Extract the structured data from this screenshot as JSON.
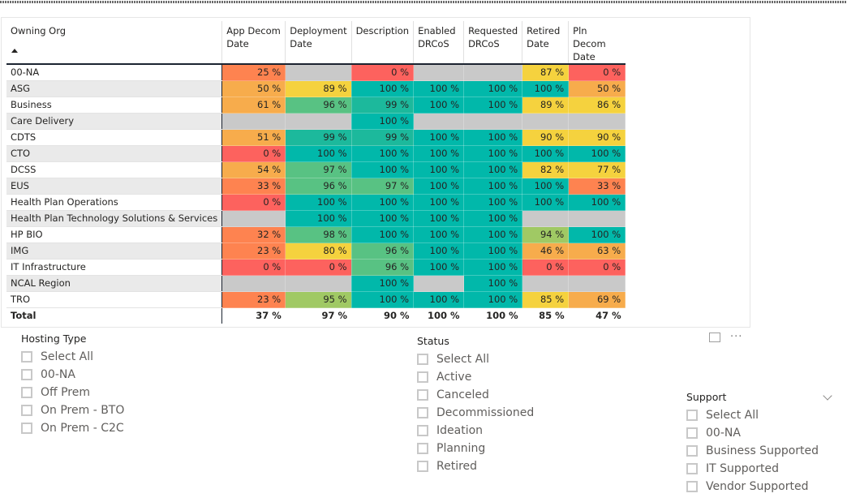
{
  "matrix": {
    "row_header": "Owning Org",
    "columns": [
      "App Decom Date",
      "Deployment Date",
      "Description",
      "Enabled DRCoS",
      "Requested DRCoS",
      "Retired Date",
      "Pln Decom Date"
    ],
    "column_lines": [
      [
        "App Decom",
        "Date"
      ],
      [
        "Deployment",
        "Date"
      ],
      [
        "Description",
        ""
      ],
      [
        "Enabled",
        "DRCoS"
      ],
      [
        "Requested",
        "DRCoS"
      ],
      [
        "Retired",
        "Date"
      ],
      [
        "Pln Decom",
        "Date"
      ]
    ],
    "rows": [
      {
        "org": "00-NA",
        "values": [
          "25 %",
          "",
          "0 %",
          "",
          "",
          "87 %",
          "0 %"
        ]
      },
      {
        "org": "ASG",
        "values": [
          "50 %",
          "89 %",
          "100 %",
          "100 %",
          "100 %",
          "100 %",
          "50 %"
        ]
      },
      {
        "org": "Business",
        "values": [
          "61 %",
          "96 %",
          "99 %",
          "100 %",
          "100 %",
          "89 %",
          "86 %"
        ]
      },
      {
        "org": "Care Delivery",
        "values": [
          "",
          "",
          "100 %",
          "",
          "",
          "",
          ""
        ]
      },
      {
        "org": "CDTS",
        "values": [
          "51 %",
          "99 %",
          "99 %",
          "100 %",
          "100 %",
          "90 %",
          "90 %"
        ]
      },
      {
        "org": "CTO",
        "values": [
          "0 %",
          "100 %",
          "100 %",
          "100 %",
          "100 %",
          "100 %",
          "100 %"
        ]
      },
      {
        "org": "DCSS",
        "values": [
          "54 %",
          "97 %",
          "100 %",
          "100 %",
          "100 %",
          "82 %",
          "77 %"
        ]
      },
      {
        "org": "EUS",
        "values": [
          "33 %",
          "96 %",
          "97 %",
          "100 %",
          "100 %",
          "100 %",
          "33 %"
        ]
      },
      {
        "org": "Health Plan Operations",
        "values": [
          "0 %",
          "100 %",
          "100 %",
          "100 %",
          "100 %",
          "100 %",
          "100 %"
        ]
      },
      {
        "org": "Health Plan Technology Solutions & Services",
        "values": [
          "",
          "100 %",
          "100 %",
          "100 %",
          "100 %",
          "",
          ""
        ]
      },
      {
        "org": "HP BIO",
        "values": [
          "32 %",
          "98 %",
          "100 %",
          "100 %",
          "100 %",
          "94 %",
          "100 %"
        ]
      },
      {
        "org": "IMG",
        "values": [
          "23 %",
          "80 %",
          "96 %",
          "100 %",
          "100 %",
          "46 %",
          "63 %"
        ]
      },
      {
        "org": "IT Infrastructure",
        "values": [
          "0 %",
          "0 %",
          "96 %",
          "100 %",
          "100 %",
          "0 %",
          "0 %"
        ]
      },
      {
        "org": "NCAL Region",
        "values": [
          "",
          "",
          "100 %",
          "",
          "100 %",
          "",
          ""
        ]
      },
      {
        "org": "TRO",
        "values": [
          "23 %",
          "95 %",
          "100 %",
          "100 %",
          "100 %",
          "85 %",
          "69 %"
        ]
      }
    ],
    "total": {
      "label": "Total",
      "values": [
        "37 %",
        "97 %",
        "90 %",
        "100 %",
        "100 %",
        "85 %",
        "47 %"
      ]
    },
    "colors": {
      "empty": "#c9c9c9",
      "zero": "#fd625e",
      "low": "#fe8350",
      "mid": "#f7ac4c",
      "high": "#f5d23e",
      "green_light": "#a0c964",
      "green": "#58c283",
      "teal": "#01b8aa"
    }
  },
  "slicers": {
    "hosting_type": {
      "title": "Hosting Type",
      "items": [
        "Select All",
        "00-NA",
        "Off Prem",
        "On Prem - BTO",
        "On Prem - C2C"
      ]
    },
    "status": {
      "title": "Status",
      "items": [
        "Select All",
        "Active",
        "Canceled",
        "Decommissioned",
        "Ideation",
        "Planning",
        "Retired"
      ]
    },
    "support": {
      "title": "Support",
      "items": [
        "Select All",
        "00-NA",
        "Business Supported",
        "IT Supported",
        "Vendor Supported"
      ]
    }
  },
  "visual_header": {
    "focus_mode_icon": "focus-mode-icon",
    "more_options_label": "···"
  }
}
